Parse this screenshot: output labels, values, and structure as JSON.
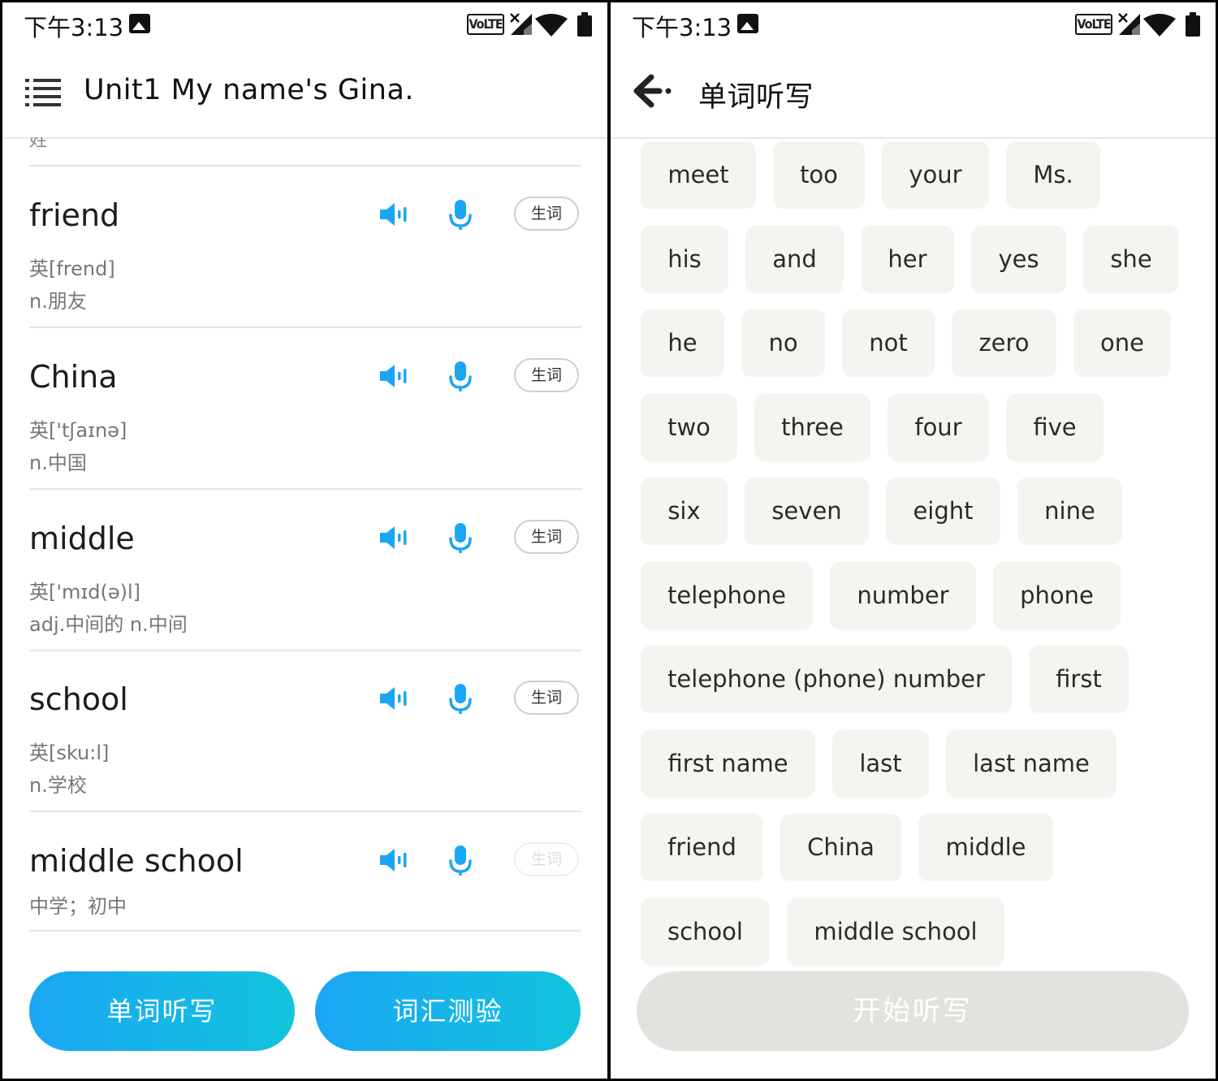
{
  "status_bar": {
    "time": "下午3:13",
    "network": "VoLTE"
  },
  "left": {
    "title": "Unit1 My name's Gina.",
    "cut_text": "姓",
    "words": [
      {
        "word": "friend",
        "phonetic": "英[frend]",
        "meaning": "n.朋友",
        "tag": "生词",
        "tag_enabled": true
      },
      {
        "word": "China",
        "phonetic": "英['tʃaɪnə]",
        "meaning": "n.中国",
        "tag": "生词",
        "tag_enabled": true
      },
      {
        "word": "middle",
        "phonetic": "英['mɪd(ə)l]",
        "meaning": "adj.中间的 n.中间",
        "tag": "生词",
        "tag_enabled": true
      },
      {
        "word": "school",
        "phonetic": "英[sku:l]",
        "meaning": "n.学校",
        "tag": "生词",
        "tag_enabled": true
      },
      {
        "word": "middle school",
        "phonetic": "",
        "meaning": "中学；初中",
        "tag": "生词",
        "tag_enabled": false
      }
    ],
    "buttons": {
      "dictation": "单词听写",
      "quiz": "词汇测验"
    }
  },
  "right": {
    "title": "单词听写",
    "chip_rows": [
      [
        "meet",
        "too",
        "your",
        "Ms."
      ],
      [
        "his",
        "and",
        "her",
        "yes",
        "she"
      ],
      [
        "he",
        "no",
        "not",
        "zero",
        "one"
      ],
      [
        "two",
        "three",
        "four",
        "five"
      ],
      [
        "six",
        "seven",
        "eight",
        "nine"
      ],
      [
        "telephone",
        "number",
        "phone"
      ],
      [
        "telephone (phone) number",
        "first"
      ],
      [
        "first name",
        "last",
        "last name"
      ],
      [
        "friend",
        "China",
        "middle"
      ],
      [
        "school",
        "middle school"
      ]
    ],
    "start_button": "开始听写"
  },
  "colors": {
    "accent": "#1aa6f4",
    "accent_end": "#12c4dc",
    "chip_bg": "#f5f4f1",
    "disabled_button": "#e2e2df"
  }
}
